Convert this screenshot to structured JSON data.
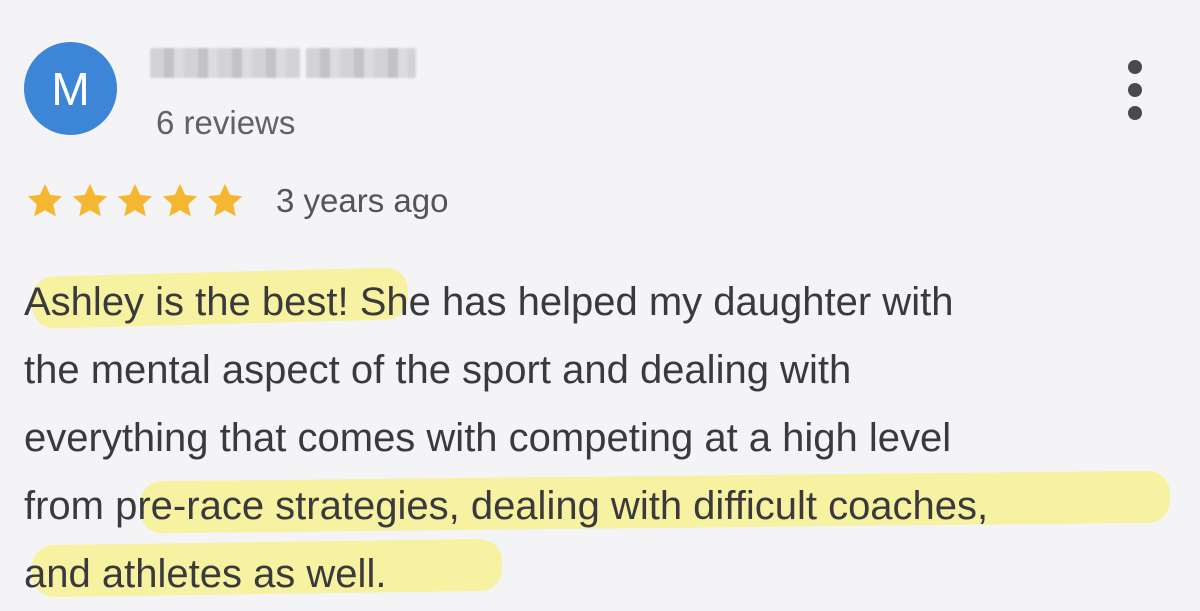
{
  "reviewer": {
    "avatar_initial": "M",
    "avatar_color": "#3d85d6",
    "review_count": "6 reviews"
  },
  "rating": {
    "stars": 5,
    "max_stars": 5,
    "star_color": "#f5b731",
    "time_ago": "3 years ago"
  },
  "review": {
    "lines": [
      "Ashley is the best! She has helped my daughter with",
      "the mental aspect of the sport and dealing with",
      "everything that comes with competing at a high level",
      "from pre-race strategies, dealing with difficult coaches,",
      "and athletes as well."
    ],
    "highlight_color": "#f6f17f"
  },
  "icons": {
    "more": "more-vertical-icon",
    "star": "star-icon"
  }
}
